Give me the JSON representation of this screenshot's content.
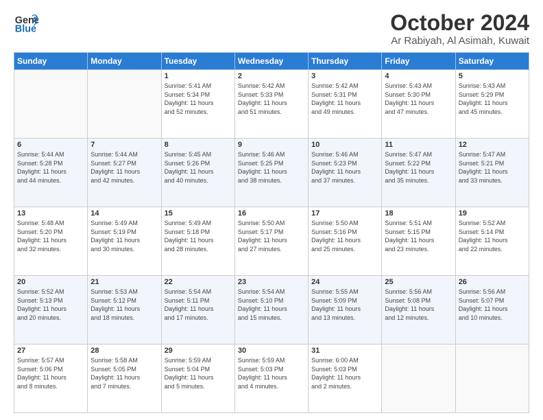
{
  "header": {
    "logo_line1": "General",
    "logo_line2": "Blue",
    "month_title": "October 2024",
    "location": "Ar Rabiyah, Al Asimah, Kuwait"
  },
  "days_of_week": [
    "Sunday",
    "Monday",
    "Tuesday",
    "Wednesday",
    "Thursday",
    "Friday",
    "Saturday"
  ],
  "weeks": [
    [
      {
        "num": "",
        "info": ""
      },
      {
        "num": "",
        "info": ""
      },
      {
        "num": "1",
        "info": "Sunrise: 5:41 AM\nSunset: 5:34 PM\nDaylight: 11 hours\nand 52 minutes."
      },
      {
        "num": "2",
        "info": "Sunrise: 5:42 AM\nSunset: 5:33 PM\nDaylight: 11 hours\nand 51 minutes."
      },
      {
        "num": "3",
        "info": "Sunrise: 5:42 AM\nSunset: 5:31 PM\nDaylight: 11 hours\nand 49 minutes."
      },
      {
        "num": "4",
        "info": "Sunrise: 5:43 AM\nSunset: 5:30 PM\nDaylight: 11 hours\nand 47 minutes."
      },
      {
        "num": "5",
        "info": "Sunrise: 5:43 AM\nSunset: 5:29 PM\nDaylight: 11 hours\nand 45 minutes."
      }
    ],
    [
      {
        "num": "6",
        "info": "Sunrise: 5:44 AM\nSunset: 5:28 PM\nDaylight: 11 hours\nand 44 minutes."
      },
      {
        "num": "7",
        "info": "Sunrise: 5:44 AM\nSunset: 5:27 PM\nDaylight: 11 hours\nand 42 minutes."
      },
      {
        "num": "8",
        "info": "Sunrise: 5:45 AM\nSunset: 5:26 PM\nDaylight: 11 hours\nand 40 minutes."
      },
      {
        "num": "9",
        "info": "Sunrise: 5:46 AM\nSunset: 5:25 PM\nDaylight: 11 hours\nand 38 minutes."
      },
      {
        "num": "10",
        "info": "Sunrise: 5:46 AM\nSunset: 5:23 PM\nDaylight: 11 hours\nand 37 minutes."
      },
      {
        "num": "11",
        "info": "Sunrise: 5:47 AM\nSunset: 5:22 PM\nDaylight: 11 hours\nand 35 minutes."
      },
      {
        "num": "12",
        "info": "Sunrise: 5:47 AM\nSunset: 5:21 PM\nDaylight: 11 hours\nand 33 minutes."
      }
    ],
    [
      {
        "num": "13",
        "info": "Sunrise: 5:48 AM\nSunset: 5:20 PM\nDaylight: 11 hours\nand 32 minutes."
      },
      {
        "num": "14",
        "info": "Sunrise: 5:49 AM\nSunset: 5:19 PM\nDaylight: 11 hours\nand 30 minutes."
      },
      {
        "num": "15",
        "info": "Sunrise: 5:49 AM\nSunset: 5:18 PM\nDaylight: 11 hours\nand 28 minutes."
      },
      {
        "num": "16",
        "info": "Sunrise: 5:50 AM\nSunset: 5:17 PM\nDaylight: 11 hours\nand 27 minutes."
      },
      {
        "num": "17",
        "info": "Sunrise: 5:50 AM\nSunset: 5:16 PM\nDaylight: 11 hours\nand 25 minutes."
      },
      {
        "num": "18",
        "info": "Sunrise: 5:51 AM\nSunset: 5:15 PM\nDaylight: 11 hours\nand 23 minutes."
      },
      {
        "num": "19",
        "info": "Sunrise: 5:52 AM\nSunset: 5:14 PM\nDaylight: 11 hours\nand 22 minutes."
      }
    ],
    [
      {
        "num": "20",
        "info": "Sunrise: 5:52 AM\nSunset: 5:13 PM\nDaylight: 11 hours\nand 20 minutes."
      },
      {
        "num": "21",
        "info": "Sunrise: 5:53 AM\nSunset: 5:12 PM\nDaylight: 11 hours\nand 18 minutes."
      },
      {
        "num": "22",
        "info": "Sunrise: 5:54 AM\nSunset: 5:11 PM\nDaylight: 11 hours\nand 17 minutes."
      },
      {
        "num": "23",
        "info": "Sunrise: 5:54 AM\nSunset: 5:10 PM\nDaylight: 11 hours\nand 15 minutes."
      },
      {
        "num": "24",
        "info": "Sunrise: 5:55 AM\nSunset: 5:09 PM\nDaylight: 11 hours\nand 13 minutes."
      },
      {
        "num": "25",
        "info": "Sunrise: 5:56 AM\nSunset: 5:08 PM\nDaylight: 11 hours\nand 12 minutes."
      },
      {
        "num": "26",
        "info": "Sunrise: 5:56 AM\nSunset: 5:07 PM\nDaylight: 11 hours\nand 10 minutes."
      }
    ],
    [
      {
        "num": "27",
        "info": "Sunrise: 5:57 AM\nSunset: 5:06 PM\nDaylight: 11 hours\nand 8 minutes."
      },
      {
        "num": "28",
        "info": "Sunrise: 5:58 AM\nSunset: 5:05 PM\nDaylight: 11 hours\nand 7 minutes."
      },
      {
        "num": "29",
        "info": "Sunrise: 5:59 AM\nSunset: 5:04 PM\nDaylight: 11 hours\nand 5 minutes."
      },
      {
        "num": "30",
        "info": "Sunrise: 5:59 AM\nSunset: 5:03 PM\nDaylight: 11 hours\nand 4 minutes."
      },
      {
        "num": "31",
        "info": "Sunrise: 6:00 AM\nSunset: 5:03 PM\nDaylight: 11 hours\nand 2 minutes."
      },
      {
        "num": "",
        "info": ""
      },
      {
        "num": "",
        "info": ""
      }
    ]
  ]
}
